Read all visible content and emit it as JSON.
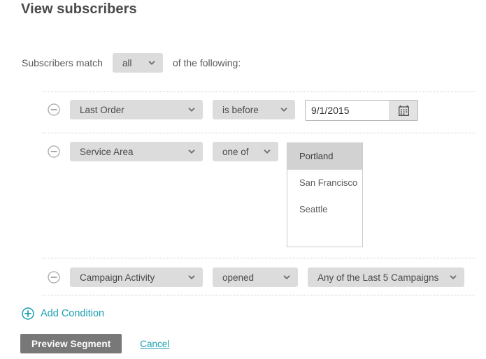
{
  "page": {
    "title": "View subscribers"
  },
  "match": {
    "prefix_label": "Subscribers match",
    "selected": "all",
    "suffix_label": "of the following:"
  },
  "conditions": [
    {
      "remove_icon": "circle-minus-icon",
      "field": "Last Order",
      "operator": "is before",
      "value_type": "date",
      "date_value": "9/1/2015",
      "date_placeholder": "",
      "calendar_icon": "calendar-icon"
    },
    {
      "remove_icon": "circle-minus-icon",
      "field": "Service Area",
      "operator": "one of",
      "value_type": "listbox",
      "options": [
        "Portland",
        "San Francisco",
        "Seattle"
      ],
      "selected_option": "Portland"
    },
    {
      "remove_icon": "circle-minus-icon",
      "field": "Campaign Activity",
      "operator": "opened",
      "value_type": "select",
      "value": "Any of the Last 5 Campaigns"
    }
  ],
  "add_condition": {
    "icon": "circle-plus-icon",
    "label": "Add Condition"
  },
  "footer": {
    "primary_label": "Preview Segment",
    "cancel_label": "Cancel"
  },
  "colors": {
    "accent": "#1a9fb2",
    "control_bg": "#dcdcdc",
    "primary_btn_bg": "#787878",
    "selected_option_bg": "#d2d2d2",
    "text": "#4a4a4a"
  }
}
